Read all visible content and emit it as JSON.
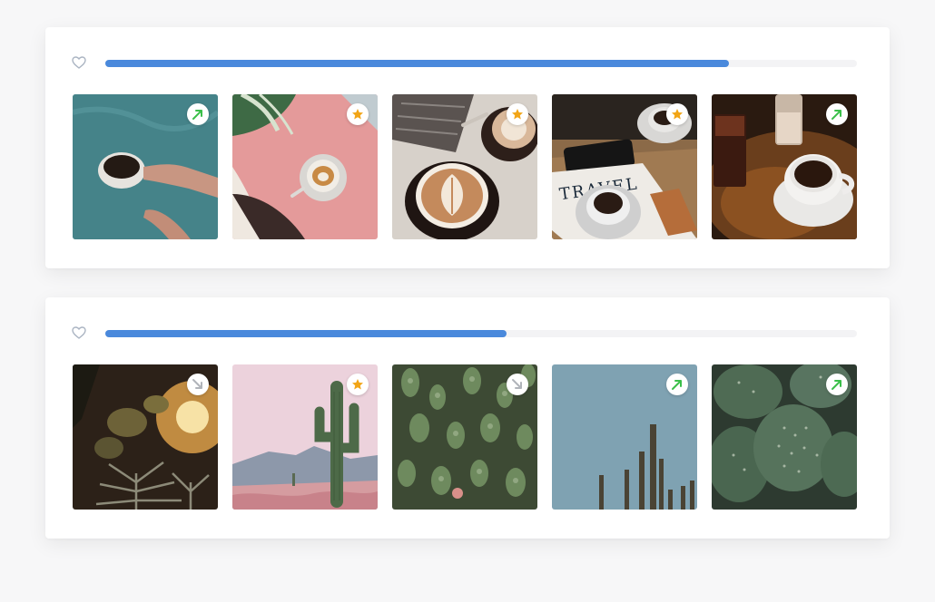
{
  "colors": {
    "progress_fill": "#4a89dc",
    "progress_track": "#f3f3f5",
    "trend_up": "#3bbf4a",
    "trend_down": "#b0b4ba",
    "star": "#f2a516",
    "heart_outline": "#aab4c2"
  },
  "collections": [
    {
      "favorite_icon": "heart-outline-icon",
      "progress": 0.83,
      "photos": [
        {
          "subject": "coffee-cup-on-teal-water",
          "badge": "trend-up-icon"
        },
        {
          "subject": "latte-on-pink-table",
          "badge": "star-icon"
        },
        {
          "subject": "two-latte-art-cups",
          "badge": "star-icon"
        },
        {
          "subject": "coffee-with-phone-and-travel-magazine",
          "badge": "star-icon"
        },
        {
          "subject": "espresso-and-iced-drinks",
          "badge": "trend-up-icon"
        }
      ]
    },
    {
      "favorite_icon": "heart-outline-icon",
      "progress": 0.534,
      "photos": [
        {
          "subject": "agave-and-cactus-at-sunset",
          "badge": "trend-down-icon"
        },
        {
          "subject": "saguaro-in-pink-desert",
          "badge": "star-icon"
        },
        {
          "subject": "cholla-cactus-field",
          "badge": "trend-down-icon"
        },
        {
          "subject": "cactus-tips-against-blue-sky",
          "badge": "trend-up-icon"
        },
        {
          "subject": "prickly-pear-pads",
          "badge": "trend-up-icon"
        }
      ]
    }
  ]
}
